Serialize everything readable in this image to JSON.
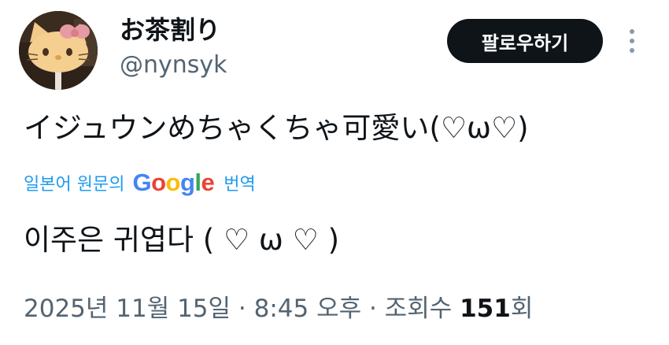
{
  "user": {
    "display_name": "お茶割り",
    "handle": "@nynsyk",
    "avatar_icon": "hello-kitty-avatar-icon"
  },
  "actions": {
    "follow_label": "팔로우하기",
    "more_icon": "vertical-ellipsis-icon"
  },
  "tweet": {
    "text": "イジュウンめちゃくちゃ可愛い(♡ω♡)"
  },
  "translation": {
    "label_prefix": "일본어 원문의",
    "provider": "Google",
    "label_suffix": "번역",
    "text": "이주은 귀엽다 ( ♡ ω ♡ )"
  },
  "meta": {
    "date_time": "2025년 11월 15일 · 8:45 오후 · 조회수",
    "views_count": "151",
    "views_suffix": "회"
  },
  "colors": {
    "follow_bg": "#0f1419",
    "link": "#1d9bf0",
    "secondary_text": "#536471",
    "google_blue": "#4285F4",
    "google_red": "#EA4335",
    "google_yellow": "#FBBC05",
    "google_green": "#34A853"
  }
}
